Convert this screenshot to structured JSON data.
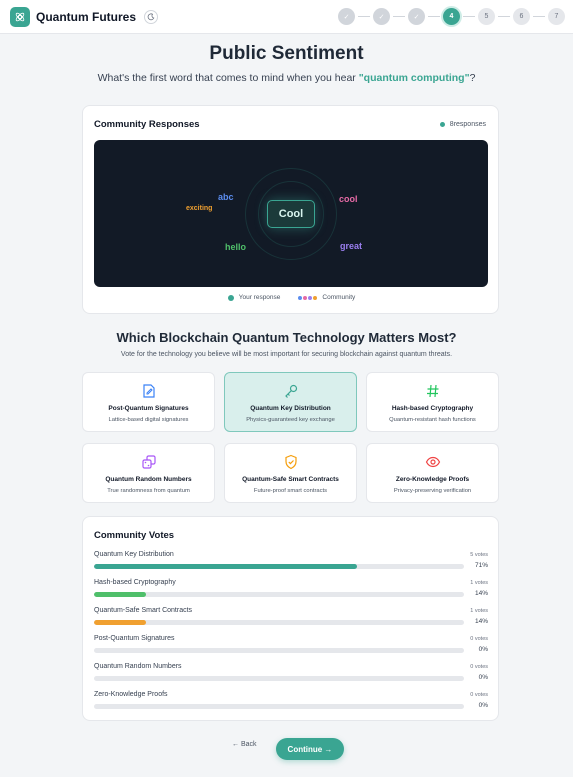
{
  "header": {
    "brand": "Quantum Futures",
    "steps": [
      {
        "label": "✓",
        "state": "done"
      },
      {
        "label": "✓",
        "state": "done"
      },
      {
        "label": "✓",
        "state": "done"
      },
      {
        "label": "4",
        "state": "active"
      },
      {
        "label": "5",
        "state": "pending"
      },
      {
        "label": "6",
        "state": "pending"
      },
      {
        "label": "7",
        "state": "pending"
      }
    ]
  },
  "sentiment": {
    "title": "Public Sentiment",
    "question_prefix": "What's the first word that comes to mind when you hear ",
    "question_highlight": "\"quantum computing\"",
    "question_suffix": "?"
  },
  "responses": {
    "title": "Community Responses",
    "count_label": "8responses",
    "center_word": "Cool",
    "words": [
      {
        "text": "abc",
        "color": "#5b8def"
      },
      {
        "text": "exciting",
        "color": "#f0a030"
      },
      {
        "text": "cool",
        "color": "#e56aa5"
      },
      {
        "text": "hello",
        "color": "#4fbf6a"
      },
      {
        "text": "great",
        "color": "#9b7ff0"
      }
    ],
    "legend": {
      "yours": "Your response",
      "community": "Community"
    },
    "legend_colors": [
      "#5b8def",
      "#e56aa5",
      "#9b7ff0",
      "#f0a030"
    ]
  },
  "tech": {
    "title": "Which Blockchain Quantum Technology Matters Most?",
    "description": "Vote for the technology you believe will be most important for securing blockchain against quantum threats.",
    "options": [
      {
        "title": "Post-Quantum Signatures",
        "subtitle": "Lattice-based digital signatures",
        "icon": "signature-icon",
        "color": "#3b82f6",
        "selected": false
      },
      {
        "title": "Quantum Key Distribution",
        "subtitle": "Physics-guaranteed key exchange",
        "icon": "key-icon",
        "color": "#3aa592",
        "selected": true
      },
      {
        "title": "Hash-based Cryptography",
        "subtitle": "Quantum-resistant hash functions",
        "icon": "hash-icon",
        "color": "#22c55e",
        "selected": false
      },
      {
        "title": "Quantum Random Numbers",
        "subtitle": "True randomness from quantum",
        "icon": "dice-icon",
        "color": "#a855f7",
        "selected": false
      },
      {
        "title": "Quantum-Safe Smart Contracts",
        "subtitle": "Future-proof smart contracts",
        "icon": "shield-icon",
        "color": "#f59e0b",
        "selected": false
      },
      {
        "title": "Zero-Knowledge Proofs",
        "subtitle": "Privacy-preserving verification",
        "icon": "eye-icon",
        "color": "#ef4444",
        "selected": false
      }
    ]
  },
  "votes": {
    "title": "Community Votes",
    "rows": [
      {
        "name": "Quantum Key Distribution",
        "count": "5 votes",
        "pct": "71%",
        "value": 71,
        "color": "#3aa592"
      },
      {
        "name": "Hash-based Cryptography",
        "count": "1 votes",
        "pct": "14%",
        "value": 14,
        "color": "#4fbf6a"
      },
      {
        "name": "Quantum-Safe Smart Contracts",
        "count": "1 votes",
        "pct": "14%",
        "value": 14,
        "color": "#f0a030"
      },
      {
        "name": "Post-Quantum Signatures",
        "count": "0 votes",
        "pct": "0%",
        "value": 0,
        "color": "#3b82f6"
      },
      {
        "name": "Quantum Random Numbers",
        "count": "0 votes",
        "pct": "0%",
        "value": 0,
        "color": "#a855f7"
      },
      {
        "name": "Zero-Knowledge Proofs",
        "count": "0 votes",
        "pct": "0%",
        "value": 0,
        "color": "#ef4444"
      }
    ]
  },
  "nav": {
    "back_label": "← Back",
    "continue_label": "Continue →"
  }
}
